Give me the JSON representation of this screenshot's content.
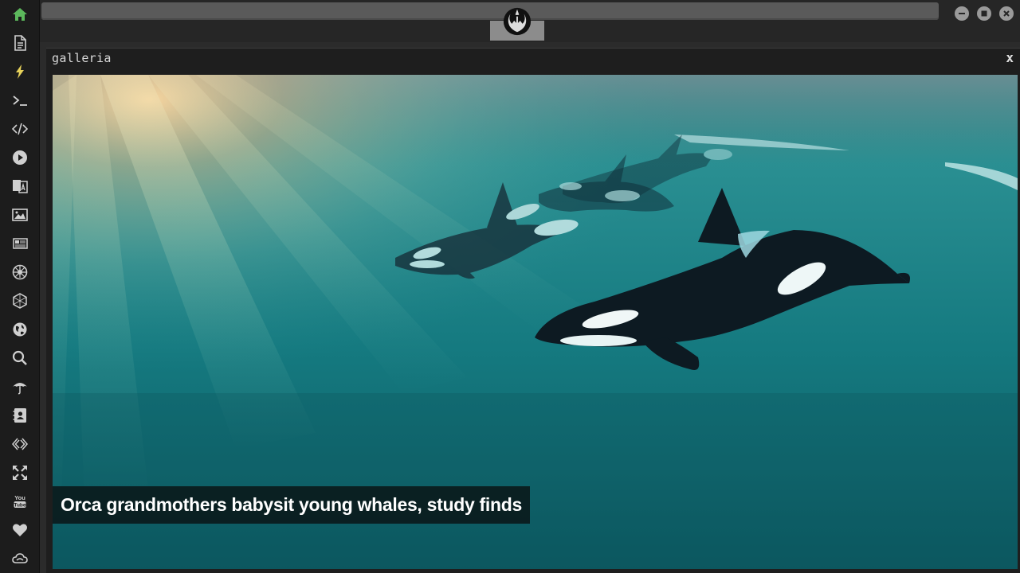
{
  "window": {
    "title": "galleria",
    "close_label": "x"
  },
  "gallery": {
    "caption": "Orca grandmothers babysit young whales, study finds",
    "image_subject": "pod of orcas swimming underwater with sun rays"
  },
  "sidebar": {
    "items": [
      {
        "icon": "home-icon",
        "active": true
      },
      {
        "icon": "document-icon"
      },
      {
        "icon": "lightning-icon",
        "highlight": true
      },
      {
        "icon": "terminal-icon"
      },
      {
        "icon": "code-icon"
      },
      {
        "icon": "play-icon"
      },
      {
        "icon": "translate-icon"
      },
      {
        "icon": "image-icon"
      },
      {
        "icon": "newspaper-icon"
      },
      {
        "icon": "empire-icon"
      },
      {
        "icon": "hexagon-icon"
      },
      {
        "icon": "globe-icon"
      },
      {
        "icon": "search-icon"
      },
      {
        "icon": "umbrella-icon"
      },
      {
        "icon": "contacts-icon"
      },
      {
        "icon": "diamond-code-icon"
      },
      {
        "icon": "expand-icon"
      },
      {
        "icon": "youtube-icon"
      },
      {
        "icon": "heart-icon"
      },
      {
        "icon": "cloud-icon"
      }
    ]
  },
  "titlebar": {
    "logo": "rebel-alliance-logo",
    "buttons": [
      "minimize-icon",
      "maximize-icon",
      "close-icon"
    ]
  },
  "colors": {
    "accent_green": "#5cb85c",
    "accent_yellow": "#e6d15a",
    "icon_grey": "#cfcfcf",
    "sidebar_bg": "#1c1c1c"
  }
}
